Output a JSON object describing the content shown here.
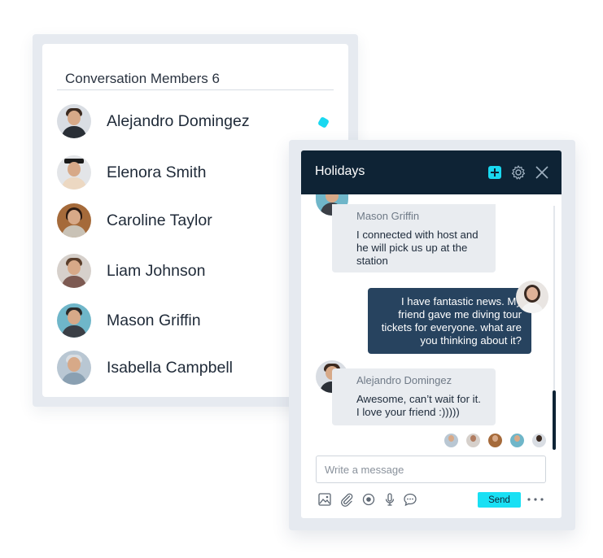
{
  "members_panel": {
    "title": "Conversation Members 6",
    "members": [
      {
        "name": "Alejandro Domingez",
        "online": true
      },
      {
        "name": "Elenora Smith",
        "online": false
      },
      {
        "name": "Caroline Taylor",
        "online": false
      },
      {
        "name": "Liam Johnson",
        "online": false
      },
      {
        "name": "Mason Griffin",
        "online": false
      },
      {
        "name": "Isabella Campbell",
        "online": false
      }
    ]
  },
  "chat": {
    "title": "Holidays",
    "messages": [
      {
        "direction": "incoming",
        "sender": "Mason Griffin",
        "text": "I connected with host and he will pick us up at the station"
      },
      {
        "direction": "outgoing",
        "text": "I have fantastic news. My friend gave me diving tour tickets for everyone. what are you thinking about it?"
      },
      {
        "direction": "incoming",
        "sender": "Alejandro Domingez",
        "text": "Awesome, can’t wait for it. I love your friend :)))))"
      }
    ],
    "input_placeholder": "Write a message",
    "send_label": "Send",
    "icons": [
      "add-icon",
      "gear-icon",
      "close-icon",
      "image-icon",
      "paperclip-icon",
      "record-icon",
      "microphone-icon",
      "chat-bubble-icon",
      "more-icon"
    ]
  },
  "colors": {
    "header_bg": "#0e2335",
    "accent": "#19d8f0",
    "outgoing_bubble": "#27435f",
    "incoming_bubble": "#e9ecf0",
    "panel_frame": "#e6eaf0"
  }
}
